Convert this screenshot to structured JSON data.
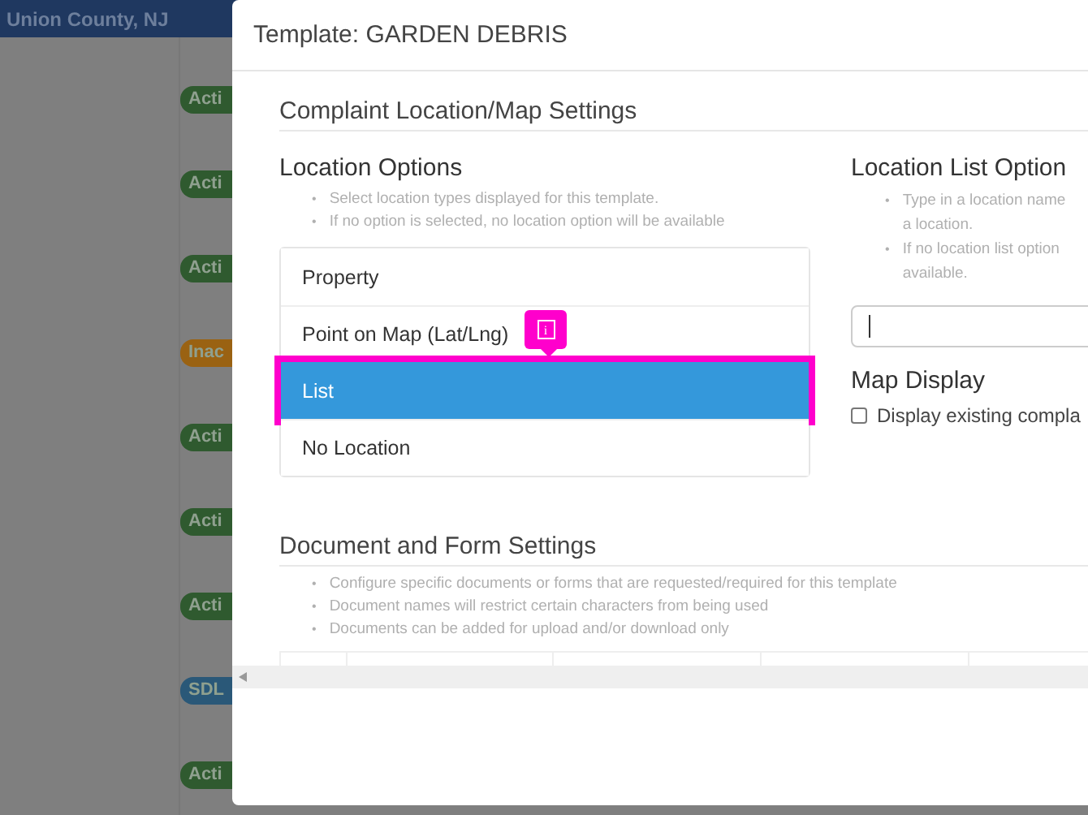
{
  "background": {
    "header_title": "Union County, NJ",
    "badges": [
      {
        "label": "Acti",
        "color": "#2f5a2f"
      },
      {
        "label": "Acti",
        "color": "#2f5a2f"
      },
      {
        "label": "Acti",
        "color": "#2f5a2f"
      },
      {
        "label": "Inac",
        "color": "#9a6212"
      },
      {
        "label": "Acti",
        "color": "#2f5a2f"
      },
      {
        "label": "Acti",
        "color": "#2f5a2f"
      },
      {
        "label": "Acti",
        "color": "#2f5a2f"
      },
      {
        "label": "SDL",
        "color": "#2a5878"
      },
      {
        "label": "Acti",
        "color": "#2f5a2f"
      }
    ]
  },
  "modal": {
    "title": "Template: GARDEN DEBRIS",
    "section_title": "Complaint Location/Map Settings",
    "location_options": {
      "heading": "Location Options",
      "hints": [
        {
          "marker": "•",
          "lines": [
            "Select location types displayed for this template."
          ]
        },
        {
          "marker": "•",
          "lines": [
            "If no option is selected, no location option will be available"
          ]
        }
      ],
      "items": [
        {
          "label": "Property",
          "selected": false
        },
        {
          "label": "Point on Map (Lat/Lng)",
          "selected": false
        },
        {
          "label": "List",
          "selected": true
        },
        {
          "label": "No Location",
          "selected": false
        }
      ],
      "tooltip": "i"
    },
    "location_list_options": {
      "heading": "Location List Option",
      "hints": [
        {
          "marker": "•",
          "lines": [
            "Type in a location name",
            "a location."
          ]
        },
        {
          "marker": "•",
          "lines": [
            "If no location list option",
            "available."
          ]
        }
      ]
    },
    "map_display": {
      "heading": "Map Display",
      "checkbox_label": "Display existing compla",
      "checked": false
    },
    "documents": {
      "heading": "Document and Form Settings",
      "hints": [
        {
          "marker": "•",
          "lines": [
            "Configure specific documents or forms that are requested/required for this template"
          ]
        },
        {
          "marker": "•",
          "lines": [
            "Document names will restrict certain characters from being used"
          ]
        },
        {
          "marker": "•",
          "lines": [
            "Documents can be added for upload and/or download only"
          ]
        }
      ]
    }
  }
}
